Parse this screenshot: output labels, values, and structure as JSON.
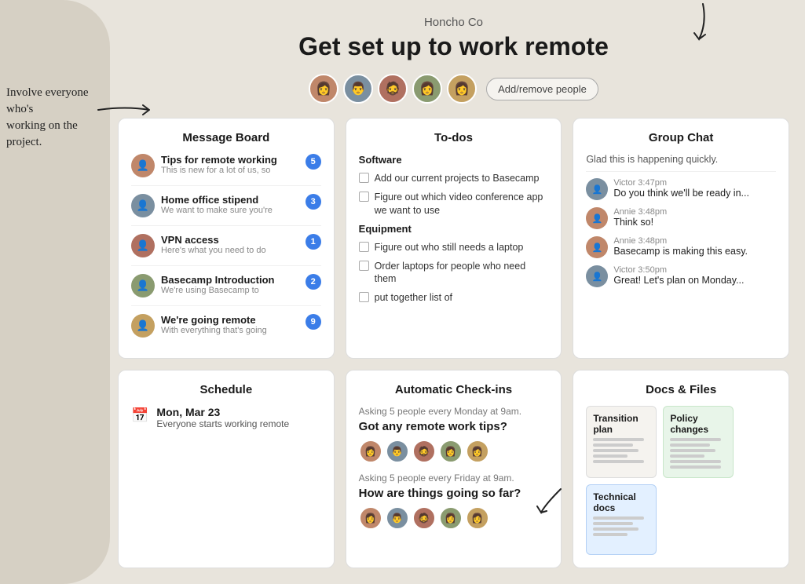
{
  "header": {
    "company": "Honcho Co",
    "title": "Get set up to work remote",
    "add_people_label": "Add/remove people"
  },
  "handwriting": {
    "line1": "Involve everyone who's",
    "line2": "working on the project."
  },
  "message_board": {
    "title": "Message Board",
    "items": [
      {
        "title": "Tips for remote working",
        "sub": "This is new for a lot of us, so",
        "badge": 5,
        "color": "#c0876a"
      },
      {
        "title": "Home office stipend",
        "sub": "We want to make sure you're",
        "badge": 3,
        "color": "#7a8fa0"
      },
      {
        "title": "VPN access",
        "sub": "Here's what you need to do",
        "badge": 1,
        "color": "#b07060"
      },
      {
        "title": "Basecamp Introduction",
        "sub": "We're using Basecamp to",
        "badge": 2,
        "color": "#8a9b70"
      },
      {
        "title": "We're going remote",
        "sub": "With everything that's going",
        "badge": 9,
        "color": "#c4a060"
      }
    ]
  },
  "todos": {
    "title": "To-dos",
    "sections": [
      {
        "name": "Software",
        "items": [
          "Add our current projects to Basecamp",
          "Figure out which video conference app we want to use"
        ]
      },
      {
        "name": "Equipment",
        "items": [
          "Figure out who still needs a laptop",
          "Order laptops for people who need them",
          "put together list of"
        ]
      }
    ]
  },
  "group_chat": {
    "title": "Group Chat",
    "first_message": "Glad this is happening quickly.",
    "messages": [
      {
        "name": "Victor",
        "time": "3:47pm",
        "text": "Do you think we'll be ready in...",
        "color": "#7a8fa0"
      },
      {
        "name": "Annie",
        "time": "3:48pm",
        "text": "Think so!",
        "color": "#c0876a"
      },
      {
        "name": "Annie",
        "time": "3:48pm",
        "text": "Basecamp is making this easy.",
        "color": "#c0876a"
      },
      {
        "name": "Victor",
        "time": "3:50pm",
        "text": "Great! Let's plan on Monday...",
        "color": "#7a8fa0"
      }
    ]
  },
  "schedule": {
    "title": "Schedule",
    "date": "Mon, Mar 23",
    "desc": "Everyone starts working remote"
  },
  "checkins": {
    "title": "Automatic Check-ins",
    "questions": [
      {
        "asking": "Asking 5 people every Monday at 9am.",
        "question": "Got any remote work tips?"
      },
      {
        "asking": "Asking 5 people every Friday at 9am.",
        "question": "How are things going so far?"
      }
    ]
  },
  "docs": {
    "title": "Docs & Files",
    "items": [
      {
        "title": "Transition plan",
        "lines": 5,
        "color": "default"
      },
      {
        "title": "Policy changes",
        "lines": 6,
        "color": "green"
      },
      {
        "title": "Technical docs",
        "lines": 4,
        "color": "blue"
      }
    ]
  }
}
